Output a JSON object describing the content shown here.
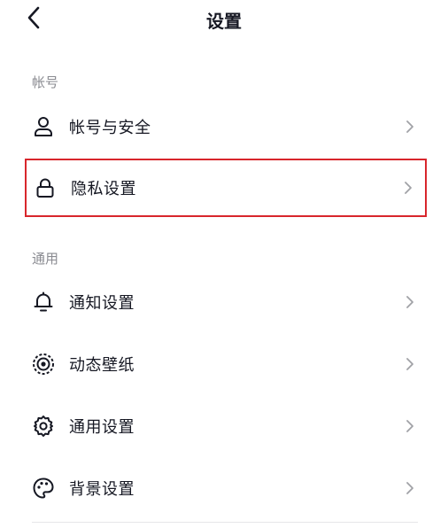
{
  "header": {
    "title": "设置",
    "back_icon": "chevron-left-icon"
  },
  "sections": [
    {
      "label": "帐号",
      "items": [
        {
          "label": "帐号与安全",
          "icon": "user-icon"
        },
        {
          "label": "隐私设置",
          "icon": "lock-icon",
          "highlighted": true,
          "highlight_color": "#d8262c"
        }
      ]
    },
    {
      "label": "通用",
      "items": [
        {
          "label": "通知设置",
          "icon": "bell-icon"
        },
        {
          "label": "动态壁纸",
          "icon": "live-wallpaper-icon"
        },
        {
          "label": "通用设置",
          "icon": "gear-icon"
        },
        {
          "label": "背景设置",
          "icon": "palette-icon"
        }
      ]
    }
  ],
  "colors": {
    "text": "#161823",
    "section_label": "#8a8b91",
    "chevron": "#a0a1a6",
    "highlight": "#d8262c"
  }
}
